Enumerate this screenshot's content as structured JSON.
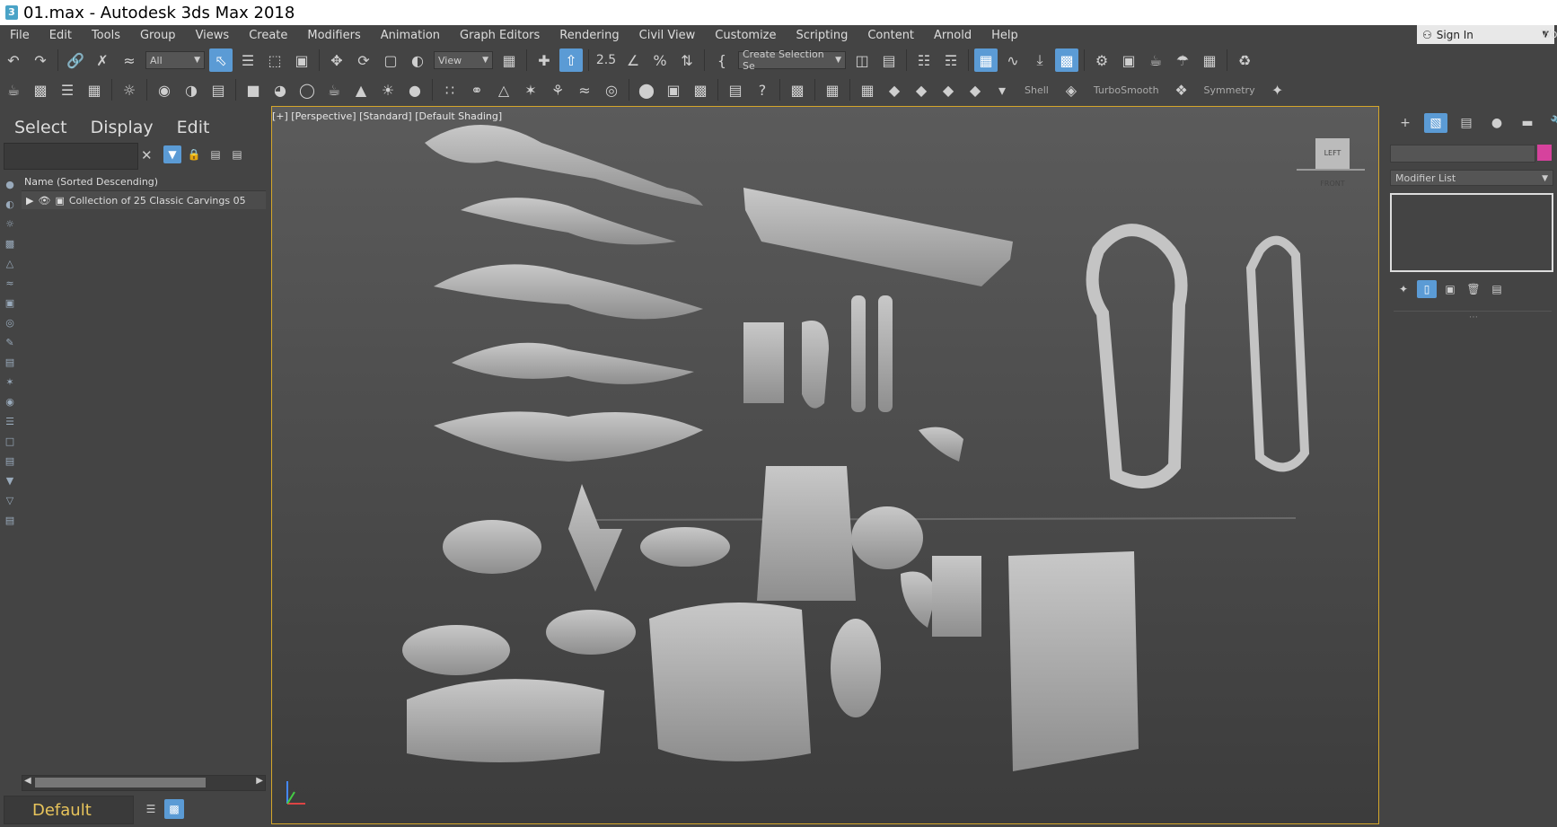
{
  "window": {
    "title": "01.max - Autodesk 3ds Max 2018",
    "app_icon": "3"
  },
  "menu": [
    "File",
    "Edit",
    "Tools",
    "Group",
    "Views",
    "Create",
    "Modifiers",
    "Animation",
    "Graph Editors",
    "Rendering",
    "Civil View",
    "Customize",
    "Scripting",
    "Content",
    "Arnold",
    "Help"
  ],
  "account": {
    "sign_in": "Sign In",
    "workspace": "Wo"
  },
  "toolbar": {
    "selection_filter": "All",
    "ref_coord": "View",
    "selection_set": "Create Selection Se",
    "snap_label": "2.5"
  },
  "toolbar2": {
    "shell": "Shell",
    "turbosmooth": "TurboSmooth",
    "symmetry": "Symmetry"
  },
  "scene_explorer": {
    "tabs": [
      "Select",
      "Display",
      "Edit"
    ],
    "column_header": "Name (Sorted Descending)",
    "rows": [
      {
        "name": "Collection of 25 Classic Carvings 05"
      }
    ],
    "layer": "Default"
  },
  "viewport": {
    "label": "[+] [Perspective] [Standard] [Default Shading]",
    "viewcube_text": "LEFT  FRONT"
  },
  "command_panel": {
    "modifier_list": "Modifier List",
    "swatch_color": "#d6429d"
  },
  "colors": {
    "accent": "#5b9bd5",
    "viewport_border": "#d4a62a",
    "layer_text": "#e8c45b"
  }
}
